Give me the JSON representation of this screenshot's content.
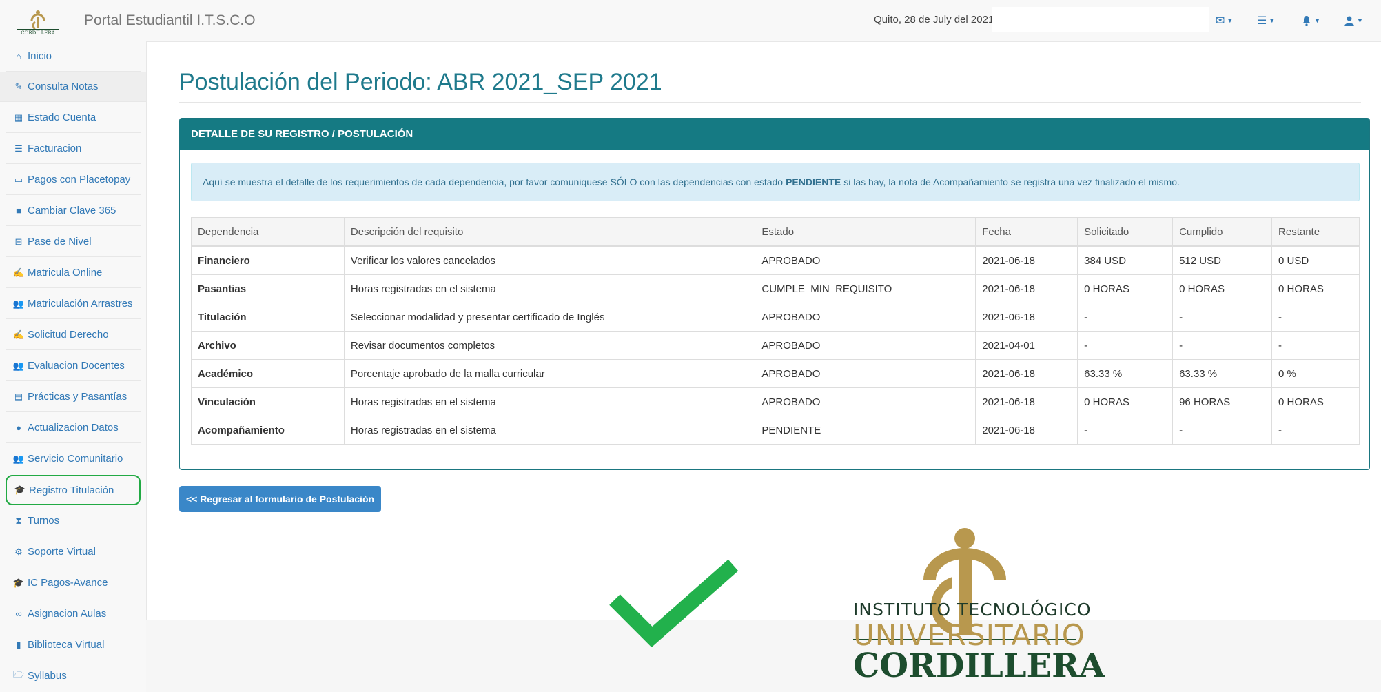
{
  "header": {
    "brand": "Portal Estudiantil I.T.S.C.O",
    "date": "Quito, 28 de July del 2021",
    "icons": [
      "envelope-icon",
      "tasks-icon",
      "bell-icon",
      "user-icon"
    ]
  },
  "sidebar": {
    "items": [
      {
        "label": "Inicio",
        "icon": "home-icon"
      },
      {
        "label": "Consulta Notas",
        "icon": "pencil-icon"
      },
      {
        "label": "Estado Cuenta",
        "icon": "calculator-icon"
      },
      {
        "label": "Facturacion",
        "icon": "list-icon"
      },
      {
        "label": "Pagos con Placetopay",
        "icon": "credit-card-icon"
      },
      {
        "label": "Cambiar Clave 365",
        "icon": "briefcase-icon"
      },
      {
        "label": "Pase de Nivel",
        "icon": "inbox-icon"
      },
      {
        "label": "Matricula Online",
        "icon": "edit-icon"
      },
      {
        "label": "Matriculación Arrastres",
        "icon": "users-icon"
      },
      {
        "label": "Solicitud Derecho",
        "icon": "edit-icon"
      },
      {
        "label": "Evaluacion Docentes",
        "icon": "users-icon"
      },
      {
        "label": "Prácticas y Pasantías",
        "icon": "building-icon"
      },
      {
        "label": "Actualizacion Datos",
        "icon": "user-icon"
      },
      {
        "label": "Servicio Comunitario",
        "icon": "users-icon"
      },
      {
        "label": "Registro Titulación",
        "icon": "graduation-cap-icon"
      },
      {
        "label": "Turnos",
        "icon": "hourglass-icon"
      },
      {
        "label": "Soporte Virtual",
        "icon": "cogs-icon"
      },
      {
        "label": "IC Pagos-Avance",
        "icon": "graduation-cap-icon"
      },
      {
        "label": "Asignacion Aulas",
        "icon": "binoculars-icon"
      },
      {
        "label": "Biblioteca Virtual",
        "icon": "book-icon"
      },
      {
        "label": "Syllabus",
        "icon": "folder-open-icon"
      }
    ]
  },
  "main": {
    "title": "Postulación del Periodo: ABR 2021_SEP 2021",
    "panel_title": "DETALLE DE SU REGISTRO / POSTULACIÓN",
    "info": {
      "part1": "Aquí se muestra el detalle de los requerimientos de cada dependencia, por favor comuniquese SÓLO con las dependencias con estado",
      "emphasis": "PENDIENTE",
      "part2": "si las hay, la nota de Acompañamiento se registra una vez finalizado el mismo."
    },
    "columns": [
      "Dependencia",
      "Descripción del requisito",
      "Estado",
      "Fecha",
      "Solicitado",
      "Cumplido",
      "Restante"
    ],
    "rows": [
      [
        "Financiero",
        "Verificar los valores cancelados",
        "APROBADO",
        "2021-06-18",
        "384 USD",
        "512 USD",
        "0 USD"
      ],
      [
        "Pasantias",
        "Horas registradas en el sistema",
        "CUMPLE_MIN_REQUISITO",
        "2021-06-18",
        "0 HORAS",
        "0 HORAS",
        "0 HORAS"
      ],
      [
        "Titulación",
        "Seleccionar modalidad y presentar certificado de Inglés",
        "APROBADO",
        "2021-06-18",
        "-",
        "-",
        "-"
      ],
      [
        "Archivo",
        "Revisar documentos completos",
        "APROBADO",
        "2021-04-01",
        "-",
        "-",
        "-"
      ],
      [
        "Académico",
        "Porcentaje aprobado de la malla curricular",
        "APROBADO",
        "2021-06-18",
        "63.33 %",
        "63.33 %",
        "0 %"
      ],
      [
        "Vinculación",
        "Horas registradas en el sistema",
        "APROBADO",
        "2021-06-18",
        "0 HORAS",
        "96 HORAS",
        "0 HORAS"
      ],
      [
        "Acompañamiento",
        "Horas registradas en el sistema",
        "PENDIENTE",
        "2021-06-18",
        "-",
        "-",
        "-"
      ]
    ],
    "back_button": "<< Regresar al formulario de Postulación"
  },
  "logo": {
    "line1": "INSTITUTO TECNOLÓGICO",
    "line2": "UNIVERSITARIO",
    "line3": "CORDILLERA"
  },
  "colors": {
    "accent": "#157a83",
    "link": "#337ab7",
    "check": "#22b14c",
    "gold": "#b8984e",
    "green_dark": "#1d4d2e"
  }
}
